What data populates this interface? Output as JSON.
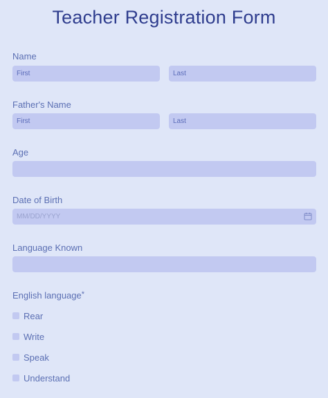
{
  "form": {
    "title": "Teacher Registration Form",
    "name": {
      "label": "Name",
      "first_placeholder": "First",
      "last_placeholder": "Last"
    },
    "fathers_name": {
      "label": "Father's Name",
      "first_placeholder": "First",
      "last_placeholder": "Last"
    },
    "age": {
      "label": "Age",
      "value": ""
    },
    "date_of_birth": {
      "label": "Date of Birth",
      "placeholder": "MM/DD/YYYY",
      "icon": "calendar-icon"
    },
    "language_known": {
      "label": "Language Known",
      "value": ""
    },
    "english_language": {
      "label": "English language",
      "required_mark": "*",
      "options": [
        {
          "label": "Rear",
          "checked": false
        },
        {
          "label": "Write",
          "checked": false
        },
        {
          "label": "Speak",
          "checked": false
        },
        {
          "label": "Understand",
          "checked": false
        }
      ]
    }
  },
  "colors": {
    "background": "#dfe6f8",
    "field_fill": "#c2c9f1",
    "title_text": "#2f3d8e",
    "label_text": "#5b6fb3"
  }
}
